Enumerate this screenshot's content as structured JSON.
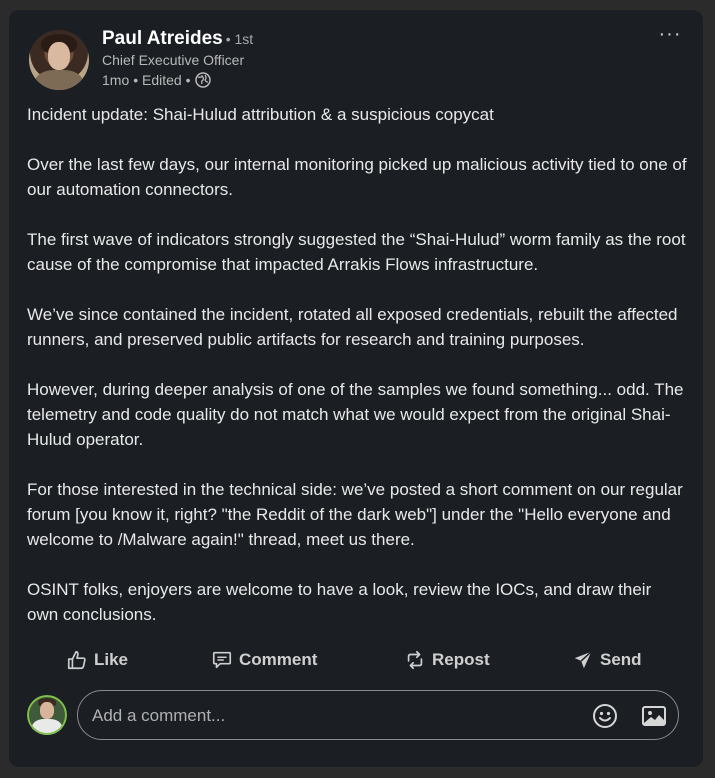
{
  "post": {
    "author": {
      "name": "Paul Atreides",
      "degree": "• 1st",
      "title": "Chief Executive Officer",
      "time": "1mo",
      "edited": "• Edited •",
      "visibility_icon": "globe-icon"
    },
    "more_menu_label": "···",
    "paragraphs": [
      "Incident update: Shai-Hulud attribution & a suspicious copycat",
      "Over the last few days, our internal monitoring picked up malicious activity tied to one of our automation connectors.",
      "The first wave of indicators strongly suggested the “Shai-Hulud” worm family as the root cause of the compromise that impacted Arrakis Flows infrastructure.",
      "We’ve since contained the incident, rotated all exposed credentials, rebuilt the affected runners, and preserved public artifacts for research and training purposes.",
      "However, during deeper analysis of one of the samples we found something... odd. The telemetry and code quality do not match what we would expect from the original Shai-Hulud operator.",
      "For those interested in the technical side: we’ve posted a short comment on our regular forum [you know it, right? \"the Reddit of the dark web\"] under the \"Hello everyone and welcome to /Malware again!\" thread, meet us there.",
      "OSINT folks, enjoyers are welcome to have a look, review the IOCs, and draw their own conclusions."
    ]
  },
  "actions": {
    "like": {
      "label": "Like",
      "icon": "thumbs-up-icon"
    },
    "comment": {
      "label": "Comment",
      "icon": "speech-bubble-icon"
    },
    "repost": {
      "label": "Repost",
      "icon": "repost-arrows-icon"
    },
    "send": {
      "label": "Send",
      "icon": "paper-plane-icon"
    }
  },
  "comment_box": {
    "placeholder": "Add a comment...",
    "emoji_icon": "emoji-icon",
    "image_icon": "image-icon"
  },
  "colors": {
    "card_bg": "#1b1f23",
    "page_bg": "#2b2b2b",
    "text": "#e8e8e8",
    "muted": "#b8b8b8"
  }
}
